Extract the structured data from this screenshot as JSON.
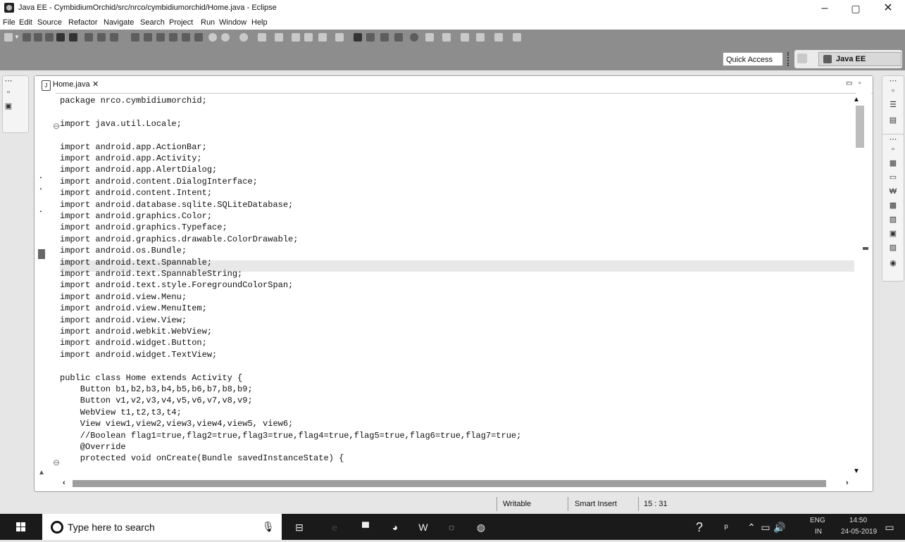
{
  "window": {
    "title": "Java EE - CymbidiumOrchid/src/nrco/cymbidiumorchid/Home.java - Eclipse",
    "minimize": "–",
    "maximize": "▢",
    "close": "✕"
  },
  "menu": [
    "File",
    "Edit",
    "Source",
    "Refactor",
    "Navigate",
    "Search",
    "Project",
    "Run",
    "Window",
    "Help"
  ],
  "toolbar": {
    "quick_access": "Quick Access",
    "perspective": "Java EE"
  },
  "editor": {
    "tab": "Home.java",
    "tab_close": "✕",
    "lines": [
      "package nrco.cymbidiumorchid;",
      "",
      "import java.util.Locale;",
      "",
      "import android.app.ActionBar;",
      "import android.app.Activity;",
      "import android.app.AlertDialog;",
      "import android.content.DialogInterface;",
      "import android.content.Intent;",
      "import android.database.sqlite.SQLiteDatabase;",
      "import android.graphics.Color;",
      "import android.graphics.Typeface;",
      "import android.graphics.drawable.ColorDrawable;",
      "import android.os.Bundle;",
      "import android.text.Spannable;",
      "import android.text.SpannableString;",
      "import android.text.style.ForegroundColorSpan;",
      "import android.view.Menu;",
      "import android.view.MenuItem;",
      "import android.view.View;",
      "import android.webkit.WebView;",
      "import android.widget.Button;",
      "import android.widget.TextView;",
      "",
      "public class Home extends Activity {",
      "    Button b1,b2,b3,b4,b5,b6,b7,b8,b9;",
      "    Button v1,v2,v3,v4,v5,v6,v7,v8,v9;",
      "    WebView t1,t2,t3,t4;",
      "    View view1,view2,view3,view4,view5, view6;",
      "    //Boolean flag1=true,flag2=true,flag3=true,flag4=true,flag5=true,flag6=true,flag7=true;",
      "    @Override",
      "    protected void onCreate(Bundle savedInstanceState) {"
    ]
  },
  "status": {
    "writable": "Writable",
    "insert_mode": "Smart Insert",
    "position": "15 : 31"
  },
  "taskbar": {
    "search_placeholder": "Type here to search",
    "lang": "ENG",
    "region": "IN",
    "time": "14:50",
    "date": "24-05-2019"
  }
}
